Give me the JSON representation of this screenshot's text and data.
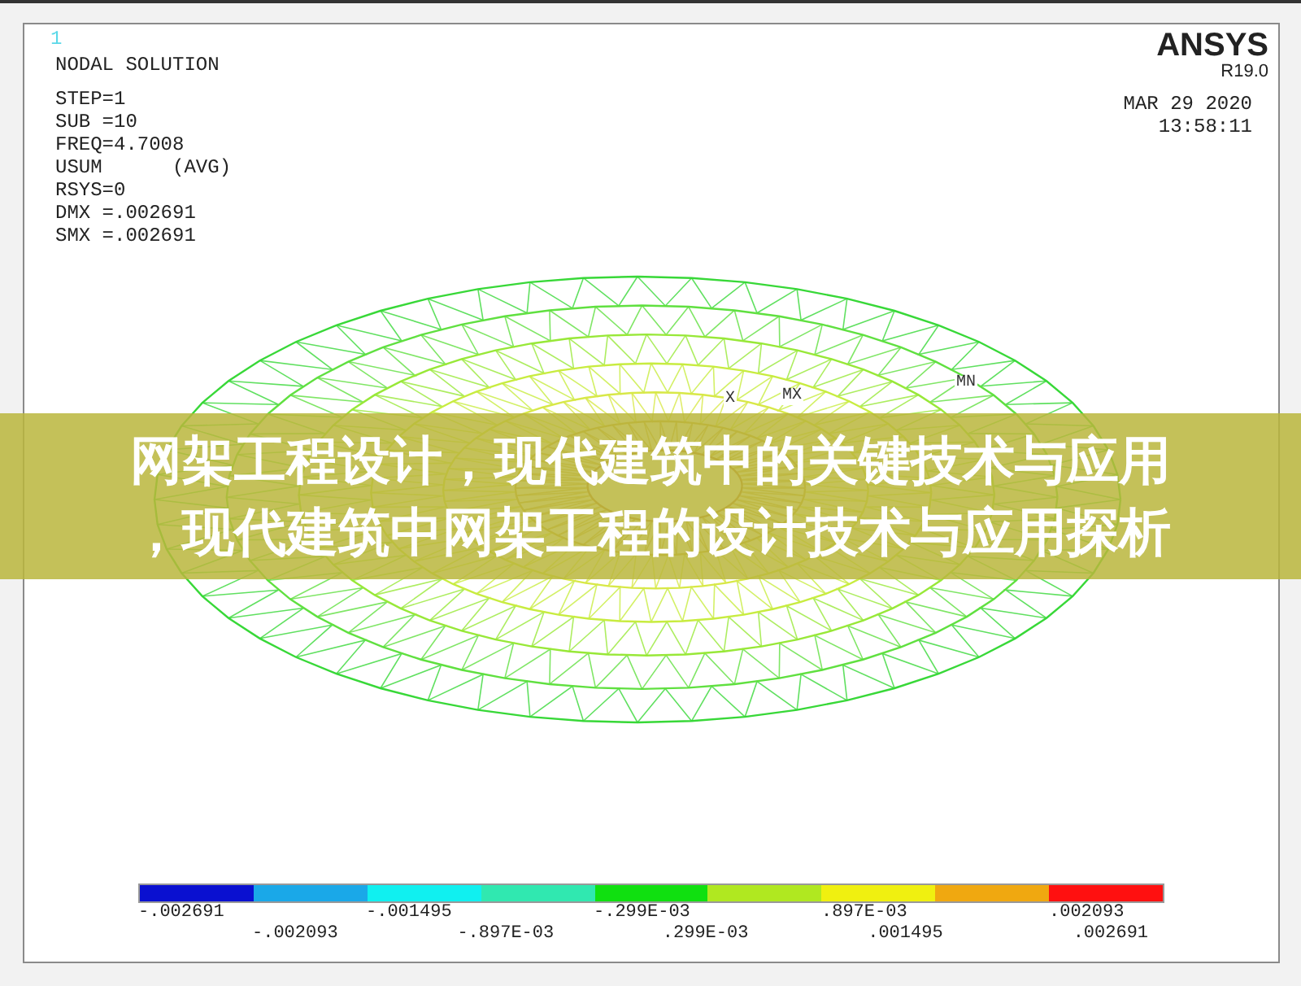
{
  "plot": {
    "window_number": "1",
    "title": "NODAL SOLUTION",
    "info_lines": [
      "STEP=1",
      "SUB =10",
      "FREQ=4.7008",
      "USUM      (AVG)",
      "RSYS=0",
      "DMX =.002691",
      "SMX =.002691"
    ],
    "brand": "ANSYS",
    "version": "R19.0",
    "date": "MAR 29 2020",
    "time": "13:58:11",
    "markers": [
      {
        "label": "MN"
      },
      {
        "label": "MX"
      },
      {
        "label": "X"
      }
    ]
  },
  "legend": {
    "segments": [
      {
        "color": "#0a10d0"
      },
      {
        "color": "#1aa8e8"
      },
      {
        "color": "#10f0f0"
      },
      {
        "color": "#30e8b0"
      },
      {
        "color": "#10e010"
      },
      {
        "color": "#b0e820"
      },
      {
        "color": "#f0f010"
      },
      {
        "color": "#f0a810"
      },
      {
        "color": "#ff1010"
      }
    ],
    "labels": [
      "-.002691",
      "-.002093",
      "-.001495",
      "-.897E-03",
      "-.299E-03",
      ".299E-03",
      ".897E-03",
      ".001495",
      ".002093",
      ".002691"
    ]
  },
  "headline": {
    "lines": [
      "网架工程设计，现代建筑中的关键技术与应用",
      "，现代建筑中网架工程的设计技术与应用探析"
    ]
  }
}
